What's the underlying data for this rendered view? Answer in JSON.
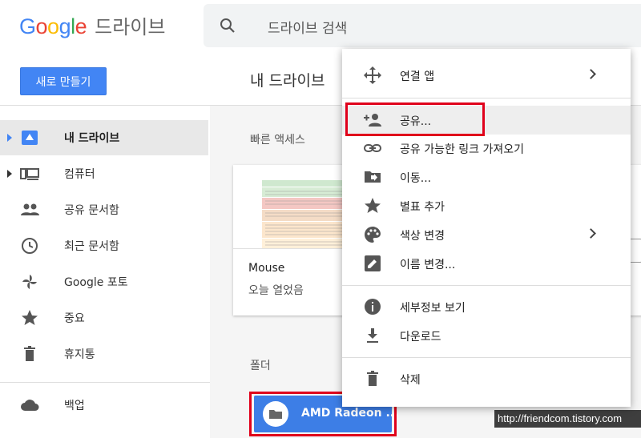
{
  "app": {
    "logo": {
      "letters": [
        {
          "ch": "G",
          "color": "#4285F4"
        },
        {
          "ch": "o",
          "color": "#EA4335"
        },
        {
          "ch": "o",
          "color": "#FBBC05"
        },
        {
          "ch": "g",
          "color": "#4285F4"
        },
        {
          "ch": "l",
          "color": "#34A853"
        },
        {
          "ch": "e",
          "color": "#EA4335"
        }
      ],
      "product": "드라이브"
    },
    "search": {
      "placeholder": "드라이브 검색"
    },
    "new_button": "새로 만들기",
    "page_title": "내 드라이브"
  },
  "sidebar": {
    "items": [
      {
        "label": "내 드라이브",
        "icon": "drive-icon",
        "active": true,
        "expandable": true
      },
      {
        "label": "컴퓨터",
        "icon": "computer-icon",
        "active": false,
        "expandable": true
      },
      {
        "label": "공유 문서함",
        "icon": "people-icon",
        "active": false,
        "expandable": false
      },
      {
        "label": "최근 문서함",
        "icon": "clock-icon",
        "active": false,
        "expandable": false
      },
      {
        "label": "Google 포토",
        "icon": "photos-icon",
        "active": false,
        "expandable": false
      },
      {
        "label": "중요",
        "icon": "star-icon",
        "active": false,
        "expandable": false
      },
      {
        "label": "휴지통",
        "icon": "trash-icon",
        "active": false,
        "expandable": false
      },
      {
        "label": "백업",
        "icon": "cloud-icon",
        "active": false,
        "expandable": false
      }
    ]
  },
  "main": {
    "quick_access_label": "빠른 액세스",
    "card": {
      "name": "Mouse",
      "subtitle": "오늘 열었음"
    },
    "folders_label": "폴더",
    "folder": {
      "name": "AMD Radeon ..."
    }
  },
  "context_menu": {
    "items": [
      {
        "label": "연결 앱",
        "icon": "move-arrows-icon",
        "submenu": true
      },
      {
        "label": "공유...",
        "icon": "person-add-icon",
        "submenu": false,
        "highlighted": true
      },
      {
        "label": "공유 가능한 링크 가져오기",
        "icon": "link-icon",
        "submenu": false
      },
      {
        "label": "이동...",
        "icon": "folder-move-icon",
        "submenu": false
      },
      {
        "label": "별표 추가",
        "icon": "star-icon",
        "submenu": false
      },
      {
        "label": "색상 변경",
        "icon": "palette-icon",
        "submenu": true
      },
      {
        "label": "이름 변경...",
        "icon": "edit-icon",
        "submenu": false
      },
      {
        "label": "세부정보 보기",
        "icon": "info-icon",
        "submenu": false
      },
      {
        "label": "다운로드",
        "icon": "download-icon",
        "submenu": false
      },
      {
        "label": "삭제",
        "icon": "trash-icon",
        "submenu": false
      }
    ]
  },
  "watermark": "http://friendcom.tistory.com",
  "colors": {
    "accent": "#4285f4",
    "highlight_box": "#e0001b",
    "folder_bg": "#3d7ee6"
  }
}
